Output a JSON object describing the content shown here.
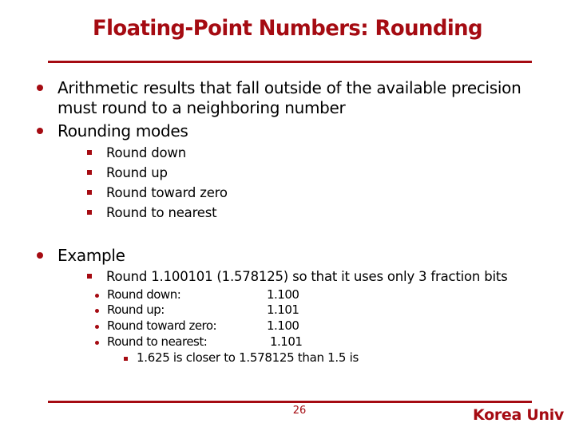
{
  "slide": {
    "title": "Floating-Point Numbers: Rounding",
    "page_number": "26",
    "brand": "Korea Univ",
    "accent_color": "#a50b12"
  },
  "bullets": [
    {
      "lines": [
        "Arithmetic results that fall outside of the available precision",
        "must round to a neighboring number"
      ]
    },
    {
      "lines": [
        "Rounding modes"
      ],
      "sub_items": [
        "Round down",
        "Round up",
        "Round toward zero",
        "Round to nearest"
      ]
    },
    {
      "lines": [
        "Example"
      ],
      "sub_items": [
        "Round 1.100101 (1.578125) so that it uses only 3 fraction bits"
      ],
      "details": [
        {
          "label": "Round down:",
          "value": "1.100"
        },
        {
          "label": "Round up:",
          "value": "1.101"
        },
        {
          "label": "Round toward zero:",
          "value": "1.100"
        },
        {
          "label": "Round to nearest:",
          "value": "1.101"
        }
      ],
      "note": "1.625 is closer to 1.578125 than 1.5 is"
    }
  ]
}
